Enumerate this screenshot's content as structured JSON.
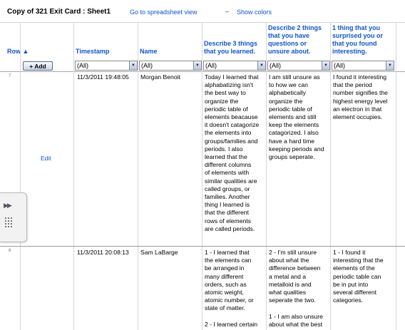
{
  "header": {
    "title": "Copy of 321 Exit Card : Sheet1",
    "spreadsheet_link": "Go to spreadsheet view",
    "separator": "–",
    "colors_link": "Show colors"
  },
  "columns": {
    "row": "Row ▲",
    "timestamp": "Timestamp",
    "name": "Name",
    "learned": [
      "Describe 3 things",
      "that you learned."
    ],
    "questions": [
      "Describe 2 things",
      "that you have",
      "questions or",
      "unsure about."
    ],
    "surprised": [
      "1 thing that you",
      "surprised you or",
      "that you found",
      "interesting."
    ]
  },
  "toolbar": {
    "add_label": "+ Add"
  },
  "filters": {
    "value": "(All)"
  },
  "rows": [
    {
      "num": "7",
      "edit": "Edit",
      "timestamp": "11/3/2011 19:48:05",
      "name": "Morgan Benoit",
      "learned": [
        "Today I learned that",
        "alphabatizing isn't",
        "the best way to",
        "organize the",
        "periodic table of",
        "elements beacause",
        "it doesn't catagorize",
        "the elements into",
        "groups/families and",
        "periods. I also",
        "learned that the",
        "different columns",
        "of elements with",
        "similar qualities are",
        "called groups, or",
        "families. Another",
        "thing I learned is",
        "that the different",
        "rows of elements",
        "are called periods."
      ],
      "questions": [
        "I am still unsure as",
        "to how we can",
        "alphabetically",
        "organize the",
        "periodic table of",
        "elements and still",
        "keep the elements",
        "catagorized. I also",
        "have a hard time",
        "keeping periods and",
        "groups seperate."
      ],
      "surprised": [
        "I found it interesting",
        "that the period",
        "number signifies the",
        "highest energy level",
        "an electron in that",
        "element occupies."
      ]
    },
    {
      "num": "8",
      "edit": "",
      "timestamp": "11/3/2011 20:08:13",
      "name": "Sam LaBarge",
      "learned": [
        "1 - I learned that",
        "the elements can",
        "be arranged in",
        "many different",
        "orders, such as",
        "atomic weight,",
        "atomic number, or",
        "state of matter.",
        "",
        "2 - I learned certain"
      ],
      "questions": [
        "2 - I'm still unsure",
        "about what the",
        "difference between",
        "a metal and a",
        "metalloid is and",
        "what qualities",
        "seperate the two.",
        "",
        "1 - I am also unsure",
        "about what the best"
      ],
      "surprised": [
        "1 - I found it",
        "interesting that the",
        "elements of the",
        "periodic table can",
        "be in put into",
        "several different",
        "categories."
      ]
    }
  ]
}
